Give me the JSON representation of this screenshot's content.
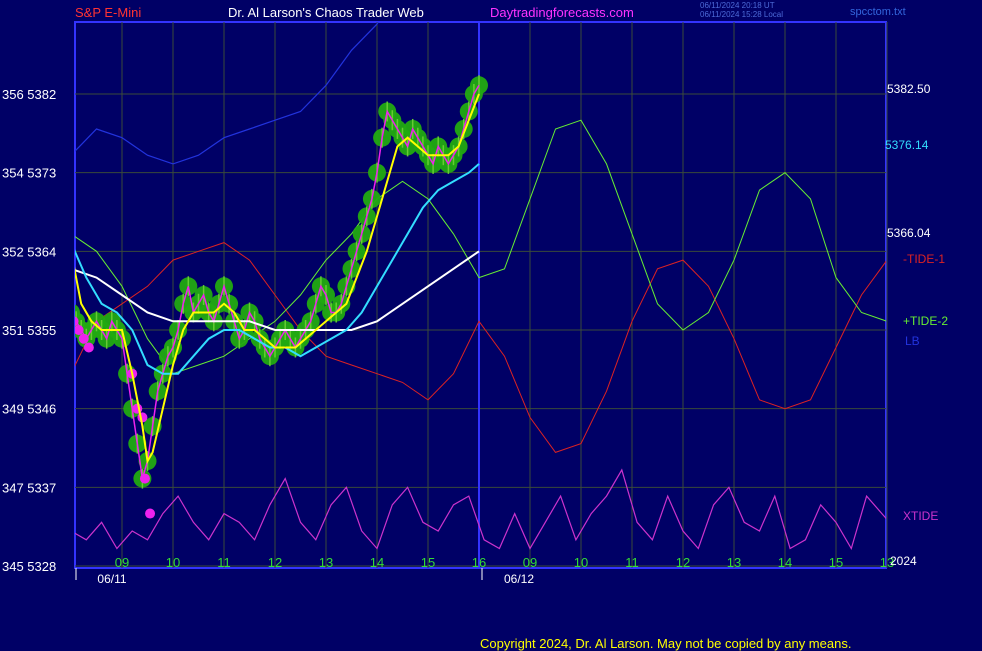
{
  "header": {
    "instrument": "S&P E-Mini",
    "site_title": "Dr. Al Larson's Chaos Trader Web",
    "site_url": "Daytradingforecasts.com",
    "timestamp_ut": "06/11/2024 20:18 UT",
    "timestamp_local": "06/11/2024 15:28 Local",
    "file": "spcctom.txt"
  },
  "colors": {
    "background": "#000066",
    "frame": "#3333ff",
    "grid": "#3a4a3a",
    "price_bar": "#66cc33",
    "price_halo": "#22aa11",
    "yellow_ma": "#ffff00",
    "cyan_ma": "#33ddff",
    "white_ma": "#ffffff",
    "tide1": "#dd2222",
    "tide2": "#66ee33",
    "lb": "#2233dd",
    "xtide": "#cc33cc",
    "magenta_dots": "#ee22ee"
  },
  "right_labels": {
    "price_top": "5382.50",
    "price_cyan": "5376.14",
    "price_white": "5366.04",
    "tide1": "-TIDE-1",
    "tide2": "+TIDE-2",
    "lb": "LB",
    "xtide": "XTIDE",
    "year": "2024"
  },
  "copyright": "Copyright 2024, Dr. Al Larson. May not be copied by any means.",
  "chart_data": {
    "type": "line",
    "title": "S&P E-Mini",
    "y_left_labels": [
      {
        "value": 5382,
        "label": "356  5382"
      },
      {
        "value": 5373,
        "label": "354  5373"
      },
      {
        "value": 5364,
        "label": "352  5364"
      },
      {
        "value": 5355,
        "label": "351  5355"
      },
      {
        "value": 5346,
        "label": "349  5346"
      },
      {
        "value": 5337,
        "label": "347  5337"
      },
      {
        "value": 5328,
        "label": "345  5328"
      }
    ],
    "ylim": [
      5328,
      5382
    ],
    "x_hours": [
      "09",
      "10",
      "11",
      "12",
      "13",
      "14",
      "15",
      "16",
      "09",
      "10",
      "11",
      "12",
      "13",
      "14",
      "15",
      "13"
    ],
    "x_dates": [
      "06/11",
      "06/12"
    ],
    "x_range": [
      8,
      17.2
    ],
    "now_hour": 16,
    "series": [
      {
        "name": "price",
        "x": [
          8.0,
          8.1,
          8.2,
          8.3,
          8.4,
          8.5,
          8.6,
          8.7,
          8.8,
          8.9,
          9.0,
          9.1,
          9.2,
          9.3,
          9.4,
          9.5,
          9.6,
          9.7,
          9.8,
          9.9,
          10.0,
          10.1,
          10.2,
          10.3,
          10.4,
          10.5,
          10.6,
          10.7,
          10.8,
          10.9,
          11.0,
          11.1,
          11.2,
          11.3,
          11.4,
          11.5,
          11.6,
          11.7,
          11.8,
          11.9,
          12.0,
          12.1,
          12.2,
          12.3,
          12.4,
          12.5,
          12.6,
          12.7,
          12.8,
          12.9,
          13.0,
          13.1,
          13.2,
          13.3,
          13.4,
          13.5,
          13.6,
          13.7,
          13.8,
          13.9,
          14.0,
          14.1,
          14.2,
          14.3,
          14.4,
          14.5,
          14.6,
          14.7,
          14.8,
          14.9,
          15.0,
          15.1,
          15.2,
          15.3,
          15.4,
          15.5,
          15.6,
          15.7,
          15.8,
          15.9,
          16.0
        ],
        "values": [
          5357,
          5356,
          5355,
          5354,
          5355,
          5356,
          5355,
          5354,
          5356,
          5355,
          5354,
          5350,
          5346,
          5342,
          5338,
          5340,
          5344,
          5348,
          5350,
          5352,
          5353,
          5355,
          5358,
          5360,
          5357,
          5358,
          5359,
          5357,
          5356,
          5358,
          5360,
          5358,
          5356,
          5354,
          5355,
          5357,
          5356,
          5354,
          5353,
          5352,
          5353,
          5354,
          5355,
          5354,
          5353,
          5354,
          5355,
          5356,
          5358,
          5360,
          5359,
          5357,
          5357,
          5358,
          5360,
          5362,
          5364,
          5366,
          5368,
          5370,
          5373,
          5377,
          5380,
          5379,
          5378,
          5377,
          5376,
          5378,
          5377,
          5376,
          5375,
          5374,
          5376,
          5375,
          5374,
          5375,
          5376,
          5378,
          5380,
          5382,
          5383
        ]
      },
      {
        "name": "yellow MA",
        "x": [
          8.0,
          8.2,
          8.4,
          8.6,
          8.8,
          9.0,
          9.2,
          9.4,
          9.5,
          9.6,
          9.8,
          10.0,
          10.2,
          10.4,
          10.6,
          10.8,
          11.0,
          11.2,
          11.4,
          11.6,
          11.8,
          12.0,
          12.2,
          12.4,
          12.6,
          12.8,
          13.0,
          13.2,
          13.4,
          13.6,
          13.8,
          14.0,
          14.2,
          14.4,
          14.6,
          14.8,
          15.0,
          15.2,
          15.4,
          15.6,
          15.8,
          16.0
        ],
        "values": [
          5364,
          5358,
          5356,
          5355,
          5355,
          5355,
          5350,
          5344,
          5340,
          5341,
          5346,
          5351,
          5355,
          5357,
          5357,
          5357,
          5358,
          5357,
          5355,
          5355,
          5354,
          5353,
          5353,
          5353,
          5354,
          5355,
          5356,
          5357,
          5358,
          5361,
          5364,
          5368,
          5372,
          5376,
          5377,
          5376,
          5375,
          5375,
          5375,
          5376,
          5379,
          5382
        ]
      },
      {
        "name": "cyan MA",
        "x": [
          8.0,
          8.3,
          8.6,
          8.9,
          9.2,
          9.5,
          9.8,
          10.1,
          10.4,
          10.7,
          11.0,
          11.3,
          11.6,
          11.9,
          12.2,
          12.5,
          12.8,
          13.1,
          13.4,
          13.7,
          14.0,
          14.3,
          14.6,
          14.9,
          15.2,
          15.5,
          15.8,
          16.0
        ],
        "values": [
          5365,
          5361,
          5358,
          5357,
          5355,
          5351,
          5350,
          5350,
          5352,
          5354,
          5355,
          5355,
          5354,
          5353,
          5353,
          5352,
          5353,
          5354,
          5355,
          5357,
          5360,
          5363,
          5366,
          5369,
          5371,
          5372,
          5373,
          5374
        ]
      },
      {
        "name": "white MA",
        "x": [
          8.0,
          8.5,
          9.0,
          9.5,
          10.0,
          10.5,
          11.0,
          11.5,
          12.0,
          12.5,
          13.0,
          13.5,
          14.0,
          14.5,
          15.0,
          15.5,
          16.0
        ],
        "values": [
          5362,
          5361,
          5359,
          5357,
          5356,
          5356,
          5356,
          5356,
          5355,
          5355,
          5355,
          5355,
          5356,
          5358,
          5360,
          5362,
          5364
        ]
      },
      {
        "name": "-TIDE-1",
        "x": [
          8.0,
          8.5,
          9.0,
          9.5,
          10.0,
          10.5,
          11.0,
          11.5,
          12.0,
          12.5,
          13.0,
          13.5,
          14.0,
          14.5,
          15.0,
          15.5,
          16.0,
          16.5,
          17.0,
          17.5,
          18.0,
          18.5,
          19.0,
          19.5,
          20.0,
          20.5,
          21.0,
          21.5,
          22.0,
          22.5,
          23.0,
          23.5,
          24.0,
          24.2
        ],
        "values": [
          5350,
          5356,
          5358,
          5360,
          5363,
          5364,
          5365,
          5363,
          5359,
          5355,
          5352,
          5351,
          5350,
          5349,
          5347,
          5350,
          5356,
          5352,
          5345,
          5341,
          5342,
          5348,
          5356,
          5362,
          5363,
          5360,
          5354,
          5347,
          5346,
          5347,
          5353,
          5359,
          5363,
          5362
        ]
      },
      {
        "name": "+TIDE-2",
        "x": [
          8.0,
          8.5,
          9.0,
          9.5,
          10.0,
          10.5,
          11.0,
          11.5,
          12.0,
          12.5,
          13.0,
          13.5,
          14.0,
          14.5,
          15.0,
          15.5,
          16.0,
          16.5,
          17.0,
          17.5,
          18.0,
          18.5,
          19.0,
          19.5,
          20.0,
          20.5,
          21.0,
          21.5,
          22.0,
          22.5,
          23.0,
          23.5,
          24.0,
          24.2
        ],
        "values": [
          5366,
          5364,
          5360,
          5354,
          5350,
          5351,
          5352,
          5354,
          5356,
          5359,
          5363,
          5366,
          5370,
          5372,
          5370,
          5366,
          5361,
          5362,
          5370,
          5378,
          5379,
          5374,
          5366,
          5358,
          5355,
          5357,
          5363,
          5371,
          5373,
          5370,
          5361,
          5357,
          5356,
          5357
        ]
      },
      {
        "name": "LB",
        "x": [
          8.0,
          8.5,
          9.0,
          9.5,
          10.0,
          10.5,
          11.0,
          11.5,
          12.0,
          12.5,
          13.0,
          13.5,
          14.0,
          14.5,
          15.0,
          15.5,
          16.0
        ],
        "values": [
          5375,
          5378,
          5377,
          5375,
          5374,
          5375,
          5377,
          5378,
          5379,
          5380,
          5383,
          5387,
          5390,
          5395,
          5398,
          5401,
          5405
        ]
      },
      {
        "name": "XTIDE",
        "x": [
          8.0,
          8.3,
          8.6,
          8.9,
          9.2,
          9.5,
          9.8,
          10.1,
          10.4,
          10.7,
          11.0,
          11.3,
          11.6,
          11.9,
          12.2,
          12.5,
          12.8,
          13.1,
          13.4,
          13.7,
          14.0,
          14.3,
          14.6,
          14.9,
          15.2,
          15.5,
          15.8,
          16.1,
          16.4,
          16.7,
          17.0,
          17.3,
          17.6,
          17.9,
          18.2,
          18.5,
          18.8,
          19.1,
          19.4,
          19.7,
          20.0,
          20.3,
          20.6,
          20.9,
          21.2,
          21.5,
          21.8,
          22.1,
          22.4,
          22.7,
          23.0,
          23.3,
          23.6,
          23.9,
          24.2
        ],
        "values": [
          5332,
          5331,
          5333,
          5330,
          5332,
          5331,
          5334,
          5336,
          5333,
          5331,
          5334,
          5333,
          5331,
          5335,
          5338,
          5333,
          5331,
          5335,
          5337,
          5332,
          5330,
          5335,
          5337,
          5333,
          5332,
          5335,
          5336,
          5331,
          5330,
          5334,
          5330,
          5333,
          5336,
          5331,
          5334,
          5336,
          5339,
          5333,
          5331,
          5336,
          5332,
          5330,
          5335,
          5337,
          5333,
          5332,
          5336,
          5330,
          5331,
          5335,
          5333,
          5330,
          5336,
          5334,
          5332
        ]
      }
    ]
  }
}
